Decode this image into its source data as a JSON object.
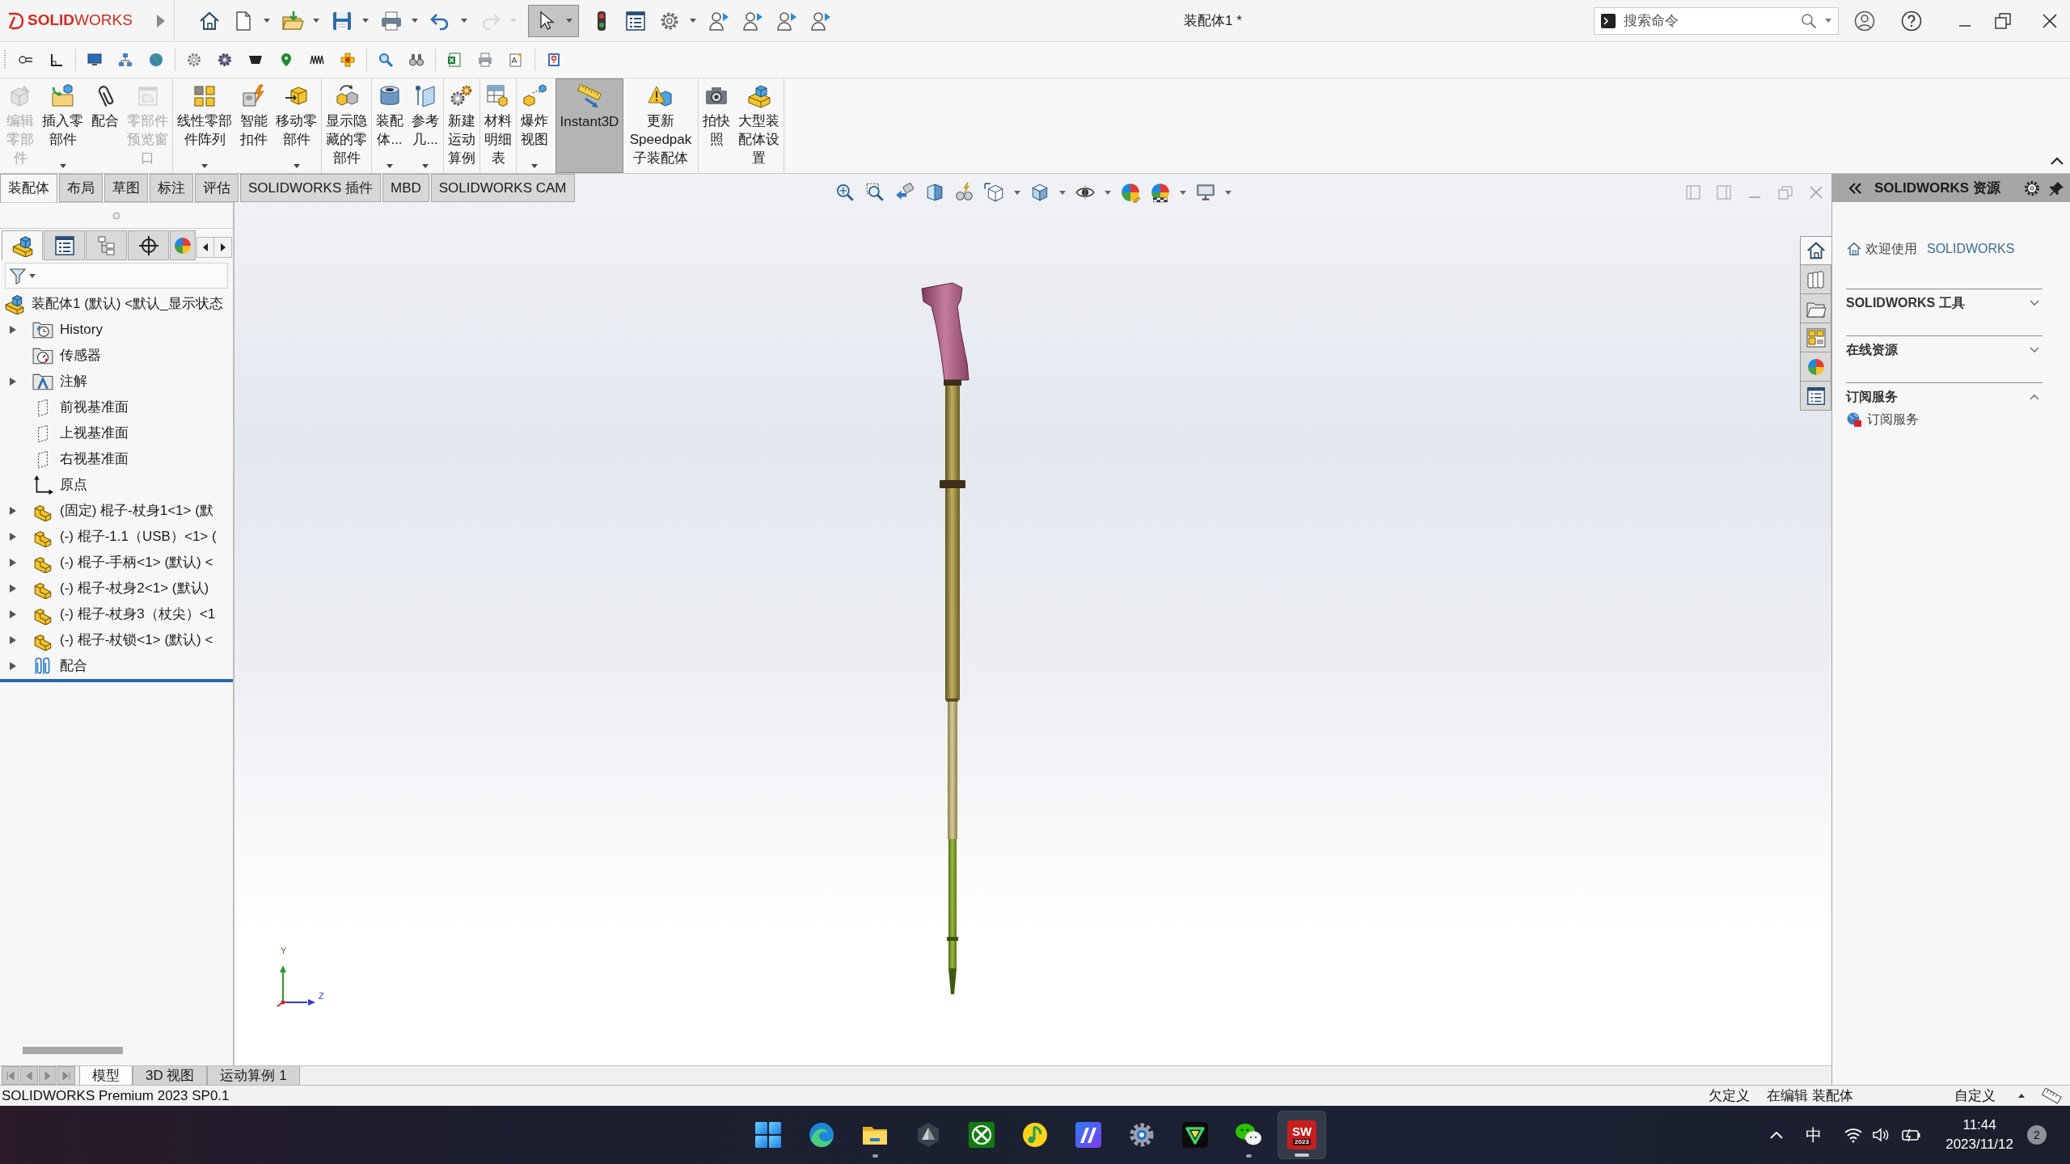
{
  "title_bar": {
    "logo": "**SOLID**WORKS",
    "quick_access": [
      {
        "kind": "home",
        "dropdown": false,
        "disabled": false,
        "pressed": false
      },
      {
        "kind": "new",
        "dropdown": true,
        "disabled": false,
        "pressed": false
      },
      {
        "kind": "open",
        "dropdown": true,
        "disabled": false,
        "pressed": false
      },
      {
        "kind": "save",
        "dropdown": true,
        "disabled": false,
        "pressed": false
      },
      {
        "kind": "print",
        "dropdown": true,
        "disabled": false,
        "pressed": false
      },
      {
        "kind": "undo",
        "dropdown": true,
        "disabled": false,
        "pressed": false
      },
      {
        "kind": "redo",
        "dropdown": true,
        "disabled": true,
        "pressed": false
      },
      {
        "kind": "select",
        "dropdown": true,
        "disabled": false,
        "pressed": true
      },
      {
        "kind": "rebuild",
        "dropdown": false,
        "disabled": false,
        "pressed": false
      },
      {
        "kind": "properties",
        "dropdown": false,
        "disabled": false,
        "pressed": false
      },
      {
        "kind": "options",
        "dropdown": true,
        "disabled": false,
        "pressed": false
      },
      {
        "kind": "person",
        "dropdown": false,
        "disabled": false,
        "pressed": false
      },
      {
        "kind": "person",
        "dropdown": false,
        "disabled": false,
        "pressed": false
      },
      {
        "kind": "person",
        "dropdown": false,
        "disabled": false,
        "pressed": false
      },
      {
        "kind": "person",
        "dropdown": false,
        "disabled": false,
        "pressed": false
      }
    ],
    "title": "装配体1 *",
    "search": {
      "placeholder": "搜索命令"
    }
  },
  "ribbon": {
    "groups": [
      [
        {
          "label": "编辑零部件",
          "disabled": true,
          "dropdown": false,
          "pressed": false
        },
        {
          "label": "插入零部件",
          "disabled": false,
          "dropdown": true,
          "pressed": false
        },
        {
          "label": "配合",
          "disabled": false,
          "dropdown": false,
          "pressed": false
        },
        {
          "label": "零部件预览窗口",
          "disabled": true,
          "dropdown": false,
          "pressed": false
        }
      ],
      [
        {
          "label": "线性零部件阵列",
          "disabled": false,
          "dropdown": true,
          "pressed": false
        },
        {
          "label": "智能扣件",
          "disabled": false,
          "dropdown": false,
          "pressed": false
        },
        {
          "label": "移动零部件",
          "disabled": false,
          "dropdown": true,
          "pressed": false
        }
      ],
      [
        {
          "label": "显示隐藏的零部件",
          "disabled": false,
          "dropdown": false,
          "pressed": false
        }
      ],
      [
        {
          "label": "装配体...",
          "disabled": false,
          "dropdown": true,
          "pressed": false
        },
        {
          "label": "参考几...",
          "disabled": false,
          "dropdown": true,
          "pressed": false
        }
      ],
      [
        {
          "label": "新建运动算例",
          "disabled": false,
          "dropdown": false,
          "pressed": false
        }
      ],
      [
        {
          "label": "材料明细表",
          "disabled": false,
          "dropdown": false,
          "pressed": false
        }
      ],
      [
        {
          "label": "爆炸视图",
          "disabled": false,
          "dropdown": true,
          "pressed": false
        },
        {
          "label": "Instant3D",
          "disabled": false,
          "dropdown": false,
          "pressed": true
        },
        {
          "label": "更新Speedpak子装配体",
          "disabled": false,
          "dropdown": false,
          "pressed": false
        }
      ],
      [
        {
          "label": "拍快照",
          "disabled": false,
          "dropdown": false,
          "pressed": false
        },
        {
          "label": "大型装配体设置",
          "disabled": false,
          "dropdown": false,
          "pressed": false
        }
      ]
    ]
  },
  "command_tabs": [
    {
      "label": "装配体",
      "selected": true
    },
    {
      "label": "布局",
      "selected": false
    },
    {
      "label": "草图",
      "selected": false
    },
    {
      "label": "标注",
      "selected": false
    },
    {
      "label": "评估",
      "selected": false
    },
    {
      "label": "SOLIDWORKS 插件",
      "selected": false
    },
    {
      "label": "MBD",
      "selected": false
    },
    {
      "label": "SOLIDWORKS CAM",
      "selected": false
    }
  ],
  "feature_manager": {
    "tabs": [
      {
        "kind": "tree",
        "selected": true
      },
      {
        "kind": "properties",
        "selected": false
      },
      {
        "kind": "configurations",
        "selected": false
      },
      {
        "kind": "dimxpert",
        "selected": false
      },
      {
        "kind": "display",
        "selected": false
      }
    ],
    "root": {
      "label": "装配体1 (默认) <默认_显示状态",
      "children": [
        {
          "kind": "history",
          "label": "History",
          "expandable": true
        },
        {
          "kind": "sensors",
          "label": "传感器",
          "expandable": false
        },
        {
          "kind": "annotations",
          "label": "注解",
          "expandable": true
        },
        {
          "kind": "plane",
          "label": "前视基准面",
          "expandable": false
        },
        {
          "kind": "plane",
          "label": "上视基准面",
          "expandable": false
        },
        {
          "kind": "plane",
          "label": "右视基准面",
          "expandable": false
        },
        {
          "kind": "origin",
          "label": "原点",
          "expandable": false
        },
        {
          "kind": "part",
          "label": "(固定) 棍子-杖身1<1> (默",
          "expandable": true
        },
        {
          "kind": "part",
          "label": "(-) 棍子-1.1（USB）<1> (",
          "expandable": true
        },
        {
          "kind": "part",
          "label": "(-) 棍子-手柄<1> (默认) <",
          "expandable": true
        },
        {
          "kind": "part",
          "label": "(-) 棍子-杖身2<1> (默认)",
          "expandable": true
        },
        {
          "kind": "part",
          "label": "(-) 棍子-杖身3（杖尖）<1",
          "expandable": true
        },
        {
          "kind": "part",
          "label": "(-) 棍子-杖锁<1> (默认) <",
          "expandable": true
        },
        {
          "kind": "mates",
          "label": "配合",
          "expandable": true
        }
      ]
    }
  },
  "graphics": {
    "triad": {
      "y_label": "Y",
      "z_label": "Z"
    }
  },
  "task_pane": {
    "title": "SOLIDWORKS 资源",
    "tabs": [
      {
        "kind": "home",
        "selected": true
      },
      {
        "kind": "library",
        "selected": false
      },
      {
        "kind": "files",
        "selected": false
      },
      {
        "kind": "palette",
        "selected": false
      },
      {
        "kind": "appearances",
        "selected": false
      },
      {
        "kind": "properties",
        "selected": false
      }
    ],
    "welcome": {
      "text": "欢迎使用",
      "product": "SOLIDWORKS"
    },
    "sections": [
      {
        "title": "SOLIDWORKS 工具",
        "expanded": false
      },
      {
        "title": "在线资源",
        "expanded": false
      },
      {
        "title": "订阅服务",
        "expanded": true,
        "items": [
          "订阅服务"
        ]
      }
    ]
  },
  "sheet_tabs": [
    {
      "label": "模型",
      "selected": true
    },
    {
      "label": "3D 视图",
      "selected": false
    },
    {
      "label": "运动算例 1",
      "selected": false
    }
  ],
  "status_bar": {
    "product": "SOLIDWORKS Premium 2023 SP0.1",
    "definition": "欠定义",
    "mode": "在编辑 装配体",
    "units": "自定义"
  },
  "taskbar": {
    "apps": [
      {
        "kind": "start",
        "running": false,
        "active": false
      },
      {
        "kind": "browser",
        "running": false,
        "active": false
      },
      {
        "kind": "explorer",
        "running": true,
        "active": false
      },
      {
        "kind": "hexagon",
        "running": false,
        "active": false
      },
      {
        "kind": "xbox",
        "running": false,
        "active": false
      },
      {
        "kind": "music",
        "running": false,
        "active": false
      },
      {
        "kind": "tile",
        "running": false,
        "active": false
      },
      {
        "kind": "settings",
        "running": false,
        "active": false
      },
      {
        "kind": "vee",
        "running": false,
        "active": false
      },
      {
        "kind": "chat",
        "running": true,
        "active": false
      },
      {
        "kind": "solidworks",
        "running": true,
        "active": true,
        "label": "SW",
        "sublabel": "2023"
      }
    ],
    "tray": {
      "ime": "中",
      "time": "11:44",
      "date": "2023/11/12",
      "notifications": "2"
    }
  }
}
